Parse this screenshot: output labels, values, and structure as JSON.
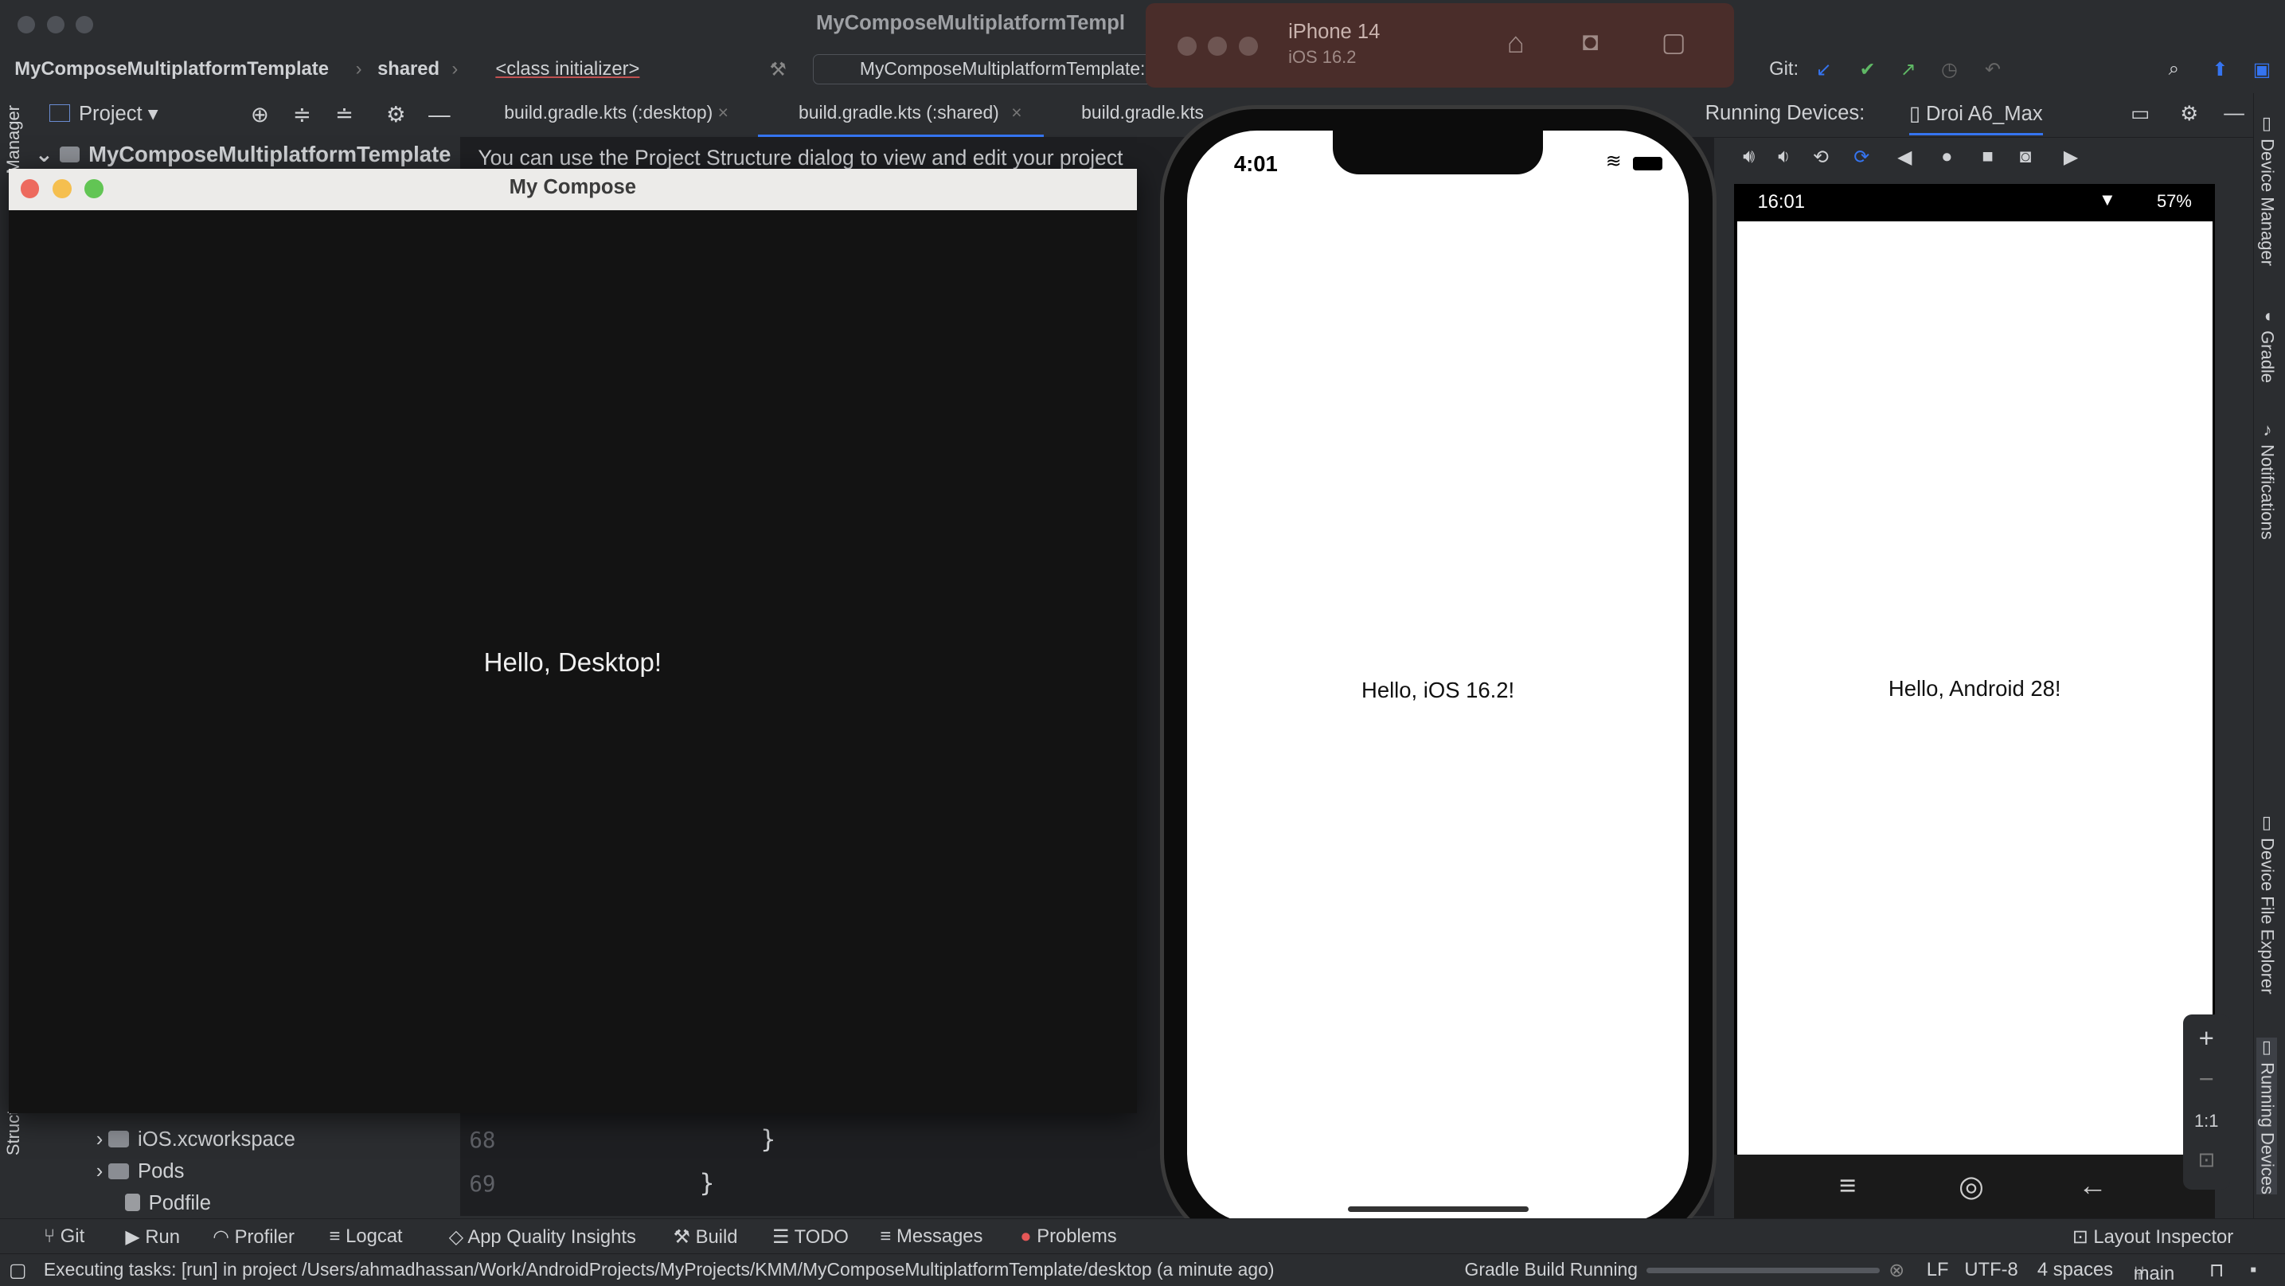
{
  "window": {
    "title": "MyComposeMultiplatformTempl"
  },
  "navbar": {
    "project": "MyComposeMultiplatformTemplate",
    "module": "shared",
    "symbol": "<class initializer>",
    "run_config": "MyComposeMultiplatformTemplate:",
    "git_label": "Git:"
  },
  "toolrow": {
    "project_label": "Project",
    "tabs": [
      "build.gradle.kts (:desktop)",
      "build.gradle.kts (:shared)",
      "build.gradle.kts"
    ],
    "running_devices_label": "Running Devices:",
    "device_name": "Droi A6_Max"
  },
  "project_tree": {
    "root": "MyComposeMultiplatformTemplate",
    "items": [
      "iOS.xcworkspace",
      "Pods",
      "Podfile"
    ]
  },
  "editor": {
    "banner": "You can use the Project Structure dialog to view and edit your project",
    "line_numbers": [
      "68",
      "69"
    ],
    "lines": [
      "}",
      "}"
    ]
  },
  "desktop_window": {
    "title": "My Compose",
    "content_text": "Hello, Desktop!"
  },
  "simulator": {
    "device": "iPhone 14",
    "os": "iOS 16.2",
    "time": "4:01",
    "content_text": "Hello, iOS 16.2!"
  },
  "android": {
    "time": "16:01",
    "battery": "57%",
    "content_text": "Hello, Android 28!",
    "zoom_fit_label": "1:1"
  },
  "right_stripe": [
    "Device Manager",
    "Gradle",
    "Notifications",
    "Device File Explorer",
    "Running Devices"
  ],
  "left_stripe": [
    "Manager",
    "Structure"
  ],
  "bottom_tools": [
    "Git",
    "Run",
    "Profiler",
    "Logcat",
    "App Quality Insights",
    "Build",
    "TODO",
    "Messages",
    "Problems",
    "Layout Inspector"
  ],
  "status": {
    "message": "Executing tasks: [run] in project /Users/ahmadhassan/Work/AndroidProjects/MyProjects/KMM/MyComposeMultiplatformTemplate/desktop (a minute ago)",
    "build": "Gradle Build Running",
    "line_sep": "LF",
    "encoding": "UTF-8",
    "indent": "4 spaces",
    "branch": "main"
  },
  "colors": {
    "ide_bg": "#2b2d30",
    "editor_bg": "#1e1f22",
    "accent_blue": "#3574f0",
    "git_green": "#5fb865"
  }
}
